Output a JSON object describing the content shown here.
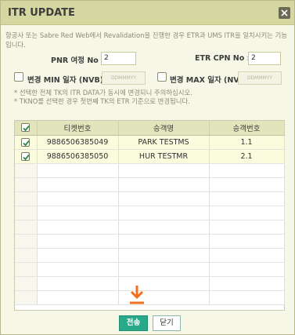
{
  "dialog": {
    "title": "ITR UPDATE",
    "close_icon": "close-x-icon"
  },
  "notice": "항공사 또는 Sabre Red Web에서 Revalidation을 진행한 경우 ETR과 UMS ITR을 일치시키는 기능입니다.",
  "form": {
    "pnr_label": "PNR 여정 No :",
    "pnr_value": "2",
    "etr_label": "ETR CPN No :",
    "etr_value": "2",
    "min_label": "변경 MIN 일자 (NVB) :",
    "min_placeholder": "DDMMMYY",
    "max_label": "변경 MAX 일자 (NVA) :",
    "max_placeholder": "DDMMMYY"
  },
  "hints": [
    "* 선택한 전체 TK의 ITR DATA가 동시에 변경되니 주의하십시오.",
    "* TKNO를 선택한 경우 첫번째 TK의 ETR 기준으로 변경됩니다."
  ],
  "table": {
    "columns": [
      "티켓번호",
      "승객명",
      "승객번호"
    ],
    "rows": [
      {
        "ticket": "9886506385049",
        "name": "PARK TESTMS",
        "pax": "1.1",
        "checked": true
      },
      {
        "ticket": "9886506385050",
        "name": "HUR TESTMR",
        "pax": "2.1",
        "checked": true
      }
    ]
  },
  "footer": {
    "send_label": "전송",
    "close_label": "닫기"
  },
  "colors": {
    "title_bar": "#d4d7a0",
    "send_button": "#28a98a",
    "arrow": "#f0701e"
  }
}
